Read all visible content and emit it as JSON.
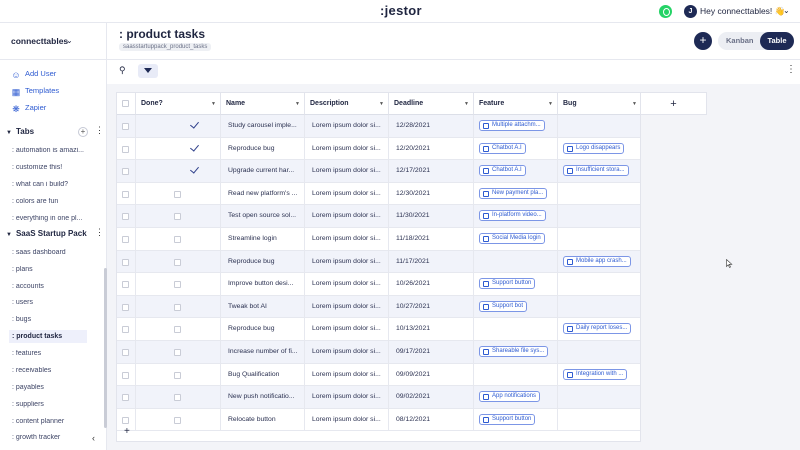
{
  "app": {
    "logo": ":jestor",
    "greeting": "Hey connecttables! 👋",
    "avatar_initial": "J",
    "accent": "#1e2a55",
    "link_color": "#2e5bd1"
  },
  "sidebar": {
    "workspace": "connecttables",
    "actions": [
      {
        "label": "Add User",
        "icon": "user-plus-icon"
      },
      {
        "label": "Templates",
        "icon": "templates-icon"
      },
      {
        "label": "Zapier",
        "icon": "zapier-icon"
      }
    ],
    "tabs_section": "Tabs",
    "tabs": [
      ": automation is amazi...",
      ": customize this!",
      ": what can i build?",
      ": colors are fun",
      ": everything in one pl..."
    ],
    "pack_section": "SaaS Startup Pack",
    "pack_items": [
      ": saas dashboard",
      ": plans",
      ": accounts",
      ": users",
      ": bugs",
      ": product tasks",
      ": features",
      ": receivables",
      ": payables",
      ": suppliers",
      ": content planner",
      ": growth tracker"
    ],
    "active_item": ": product tasks"
  },
  "header": {
    "title": ": product tasks",
    "subtitle": "saasstartuppack_product_tasks",
    "view_kanban": "Kanban",
    "view_table": "Table"
  },
  "table": {
    "columns": [
      "Done?",
      "Name",
      "Description",
      "Deadline",
      "Feature",
      "Bug"
    ],
    "rows": [
      {
        "done": true,
        "name": "Study carousel imple...",
        "description": "Lorem ipsum dolor si...",
        "deadline": "12/28/2021",
        "feature": "Multiple attachm...",
        "bug": ""
      },
      {
        "done": true,
        "name": "Reproduce bug",
        "description": "Lorem ipsum dolor si...",
        "deadline": "12/20/2021",
        "feature": "Chatbot A.I",
        "bug": "Logo disappears"
      },
      {
        "done": true,
        "name": "Upgrade current har...",
        "description": "Lorem ipsum dolor si...",
        "deadline": "12/17/2021",
        "feature": "Chatbot A.I",
        "bug": "Insufficient stora..."
      },
      {
        "done": false,
        "name": "Read new platform's ...",
        "description": "Lorem ipsum dolor si...",
        "deadline": "12/30/2021",
        "feature": "New payment pla...",
        "bug": ""
      },
      {
        "done": false,
        "name": "Test open source sol...",
        "description": "Lorem ipsum dolor si...",
        "deadline": "11/30/2021",
        "feature": "In-platform video...",
        "bug": ""
      },
      {
        "done": false,
        "name": "Streamline login",
        "description": "Lorem ipsum dolor si...",
        "deadline": "11/18/2021",
        "feature": "Social Media login",
        "bug": ""
      },
      {
        "done": false,
        "name": "Reproduce bug",
        "description": "Lorem ipsum dolor si...",
        "deadline": "11/17/2021",
        "feature": "",
        "bug": "Mobile app crash..."
      },
      {
        "done": false,
        "name": "Improve button desi...",
        "description": "Lorem ipsum dolor si...",
        "deadline": "10/26/2021",
        "feature": "Support button",
        "bug": ""
      },
      {
        "done": false,
        "name": "Tweak bot AI",
        "description": "Lorem ipsum dolor si...",
        "deadline": "10/27/2021",
        "feature": "Support bot",
        "bug": ""
      },
      {
        "done": false,
        "name": "Reproduce bug",
        "description": "Lorem ipsum dolor si...",
        "deadline": "10/13/2021",
        "feature": "",
        "bug": "Daily report loses..."
      },
      {
        "done": false,
        "name": "Increase number of fi...",
        "description": "Lorem ipsum dolor si...",
        "deadline": "09/17/2021",
        "feature": "Shareable file sys...",
        "bug": ""
      },
      {
        "done": false,
        "name": "Bug Qualification",
        "description": "Lorem ipsum dolor si...",
        "deadline": "09/09/2021",
        "feature": "",
        "bug": "Integration with ..."
      },
      {
        "done": false,
        "name": "New push notificatio...",
        "description": "Lorem ipsum dolor si...",
        "deadline": "09/02/2021",
        "feature": "App notifications",
        "bug": ""
      },
      {
        "done": false,
        "name": "Relocate button",
        "description": "Lorem ipsum dolor si...",
        "deadline": "08/12/2021",
        "feature": "Support button",
        "bug": ""
      }
    ],
    "add_column": "+",
    "add_row": "+"
  }
}
